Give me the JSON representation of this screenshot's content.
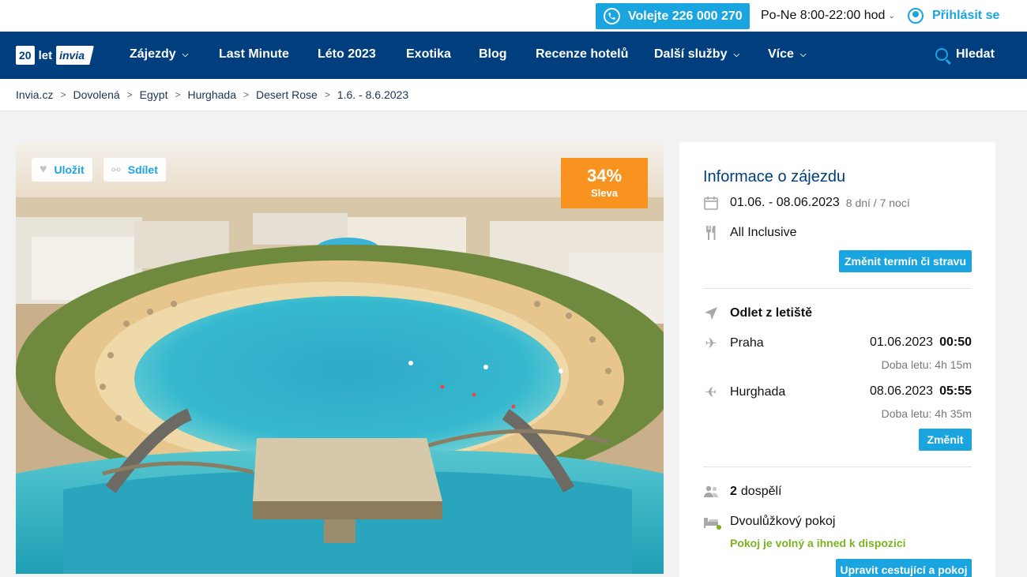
{
  "topbar": {
    "call_label": "Volejte 226 000 270",
    "hours": "Po-Ne 8:00-22:00 hod",
    "login_label": "Přihlásit se"
  },
  "logo": {
    "part1": "20",
    "part2": "let",
    "part3": "invia"
  },
  "nav": {
    "items": [
      {
        "label": "Zájezdy"
      },
      {
        "label": "Last Minute"
      },
      {
        "label": "Léto 2023"
      },
      {
        "label": "Exotika"
      },
      {
        "label": "Blog"
      },
      {
        "label": "Recenze hotelů"
      },
      {
        "label": "Další služby"
      },
      {
        "label": "Více"
      }
    ],
    "search_label": "Hledat"
  },
  "breadcrumb": [
    "Invia.cz",
    "Dovolená",
    "Egypt",
    "Hurghada",
    "Desert Rose",
    "1.6. - 8.6.2023"
  ],
  "hero": {
    "save_label": "Uložit",
    "share_label": "Sdílet",
    "discount_pct": "34%",
    "discount_label": "Sleva"
  },
  "info": {
    "title": "Informace o zájezdu",
    "dates": "01.06. - 08.06.2023",
    "duration": "8 dní / 7 nocí",
    "board": "All Inclusive",
    "change_term_button": "Změnit termín či stravu",
    "departure_heading": "Odlet z letiště",
    "outbound": {
      "city": "Praha",
      "date": "01.06.2023",
      "time": "00:50",
      "flight_time": "Doba letu: 4h 15m"
    },
    "inbound": {
      "city": "Hurghada",
      "date": "08.06.2023",
      "time": "05:55",
      "flight_time": "Doba letu: 4h 35m"
    },
    "change_flight_button": "Změnit",
    "travellers_count": "2",
    "travellers_label": "dospělí",
    "room": "Dvoulůžkový pokoj",
    "room_status": "Pokoj je volný a ihned k dispozici",
    "edit_button": "Upravit cestující a pokoj"
  },
  "colors": {
    "brand_navy": "#003e7e",
    "accent_blue": "#1ba5e0",
    "discount_orange": "#f7931e",
    "available_green": "#7bb321"
  }
}
